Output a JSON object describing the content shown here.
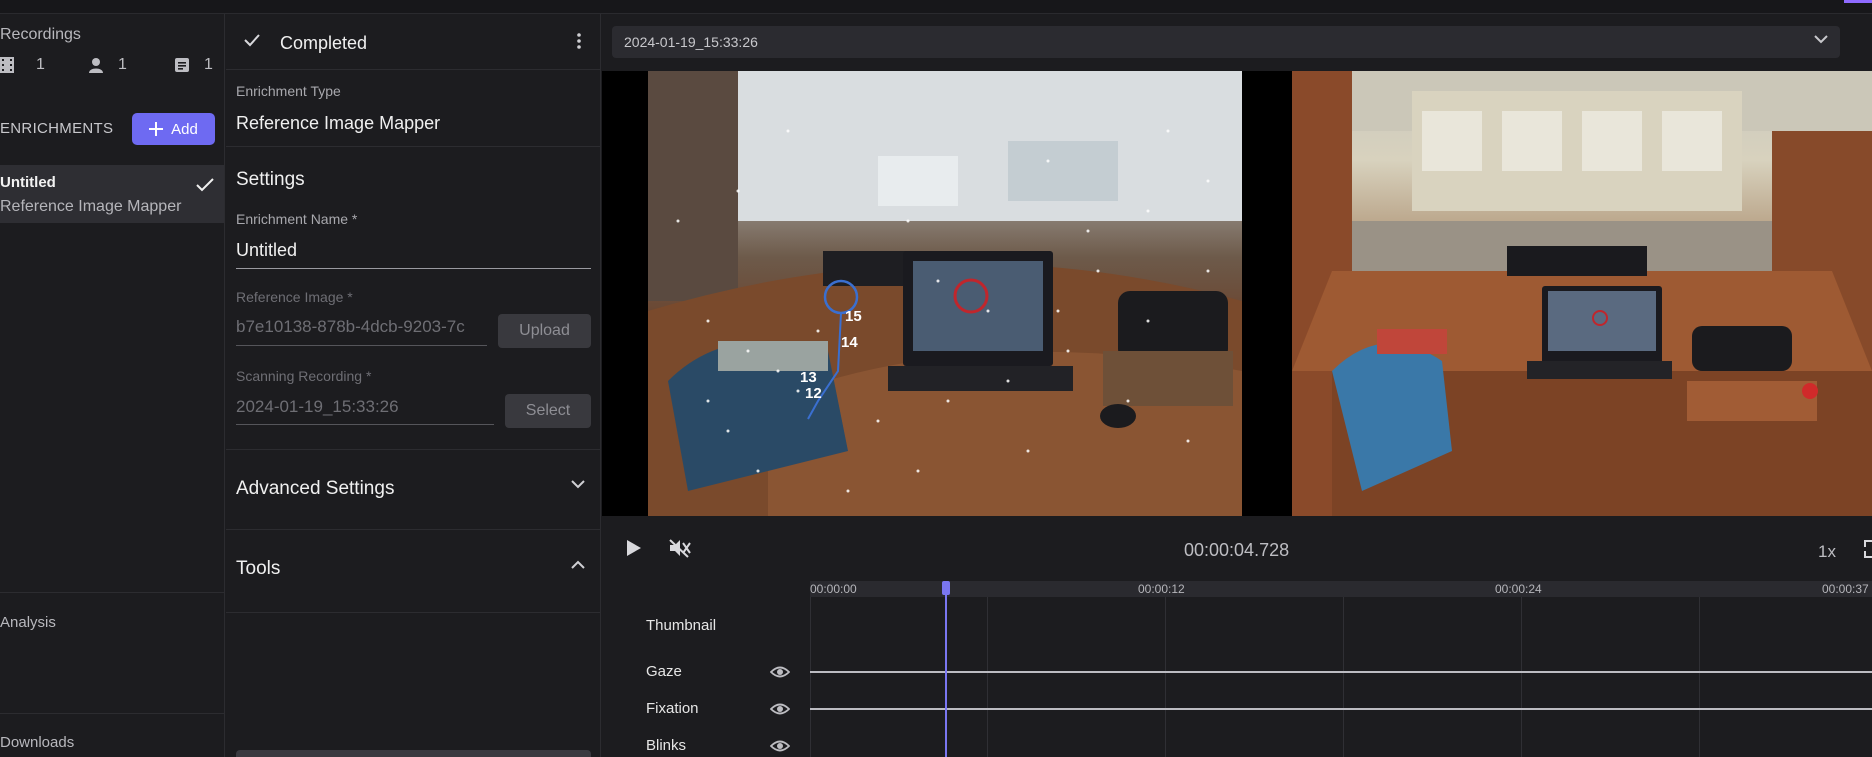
{
  "sidebar": {
    "recordings_title": "Recordings",
    "counts": {
      "videos": "1",
      "people": "1",
      "docs": "1"
    },
    "enrichments_label": "ENRICHMENTS",
    "add_label": "Add",
    "item": {
      "name": "Untitled",
      "type": "Reference Image Mapper"
    },
    "analysis_label": "Analysis",
    "downloads_label": "Downloads"
  },
  "panel": {
    "status": "Completed",
    "enrichment_type_label": "Enrichment Type",
    "enrichment_type_value": "Reference Image Mapper",
    "settings_title": "Settings",
    "name_label": "Enrichment Name *",
    "name_value": "Untitled",
    "ref_image_label": "Reference Image *",
    "ref_image_value": "b7e10138-878b-4dcb-9203-7c",
    "upload_label": "Upload",
    "scan_label": "Scanning Recording *",
    "scan_value": "2024-01-19_15:33:26",
    "select_label": "Select",
    "advanced_title": "Advanced Settings",
    "tools_title": "Tools"
  },
  "player": {
    "recording_select": "2024-01-19_15:33:26",
    "time": "00:00:04.728",
    "speed": "1x",
    "overlay_labels": [
      "15",
      "14",
      "13",
      "12"
    ]
  },
  "timeline": {
    "ticks": [
      "00:00:00",
      "00:00:12",
      "00:00:24",
      "00:00:37"
    ],
    "rows": [
      "Thumbnail",
      "Gaze",
      "Fixation",
      "Blinks"
    ],
    "playhead_fraction": 0.128
  },
  "colors": {
    "accent": "#6e6af2",
    "background": "#1c1c1f",
    "fixation_circle": "#c0262c",
    "gaze_circle": "#3a6fd0"
  }
}
